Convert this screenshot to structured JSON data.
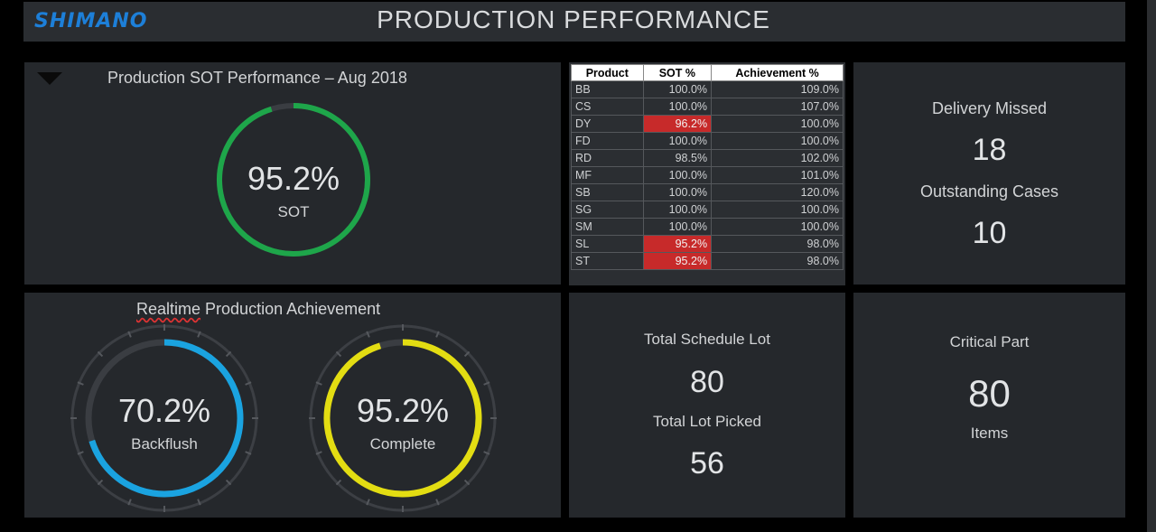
{
  "header": {
    "logo": "SHIMANO",
    "title": "PRODUCTION PERFORMANCE"
  },
  "sot_panel": {
    "title": "Production SOT Performance – Aug 2018",
    "value_text": "95.2%",
    "value": 95.2,
    "label": "SOT",
    "colors": {
      "ring": "#1ea64a",
      "track": "#3a3d42"
    }
  },
  "table": {
    "columns": [
      "Product",
      "SOT %",
      "Achievement %"
    ],
    "rows": [
      {
        "product": "BB",
        "sot": "100.0%",
        "achievement": "109.0%",
        "flag": false
      },
      {
        "product": "CS",
        "sot": "100.0%",
        "achievement": "107.0%",
        "flag": false
      },
      {
        "product": "DY",
        "sot": "96.2%",
        "achievement": "100.0%",
        "flag": true
      },
      {
        "product": "FD",
        "sot": "100.0%",
        "achievement": "100.0%",
        "flag": false
      },
      {
        "product": "RD",
        "sot": "98.5%",
        "achievement": "102.0%",
        "flag": false
      },
      {
        "product": "MF",
        "sot": "100.0%",
        "achievement": "101.0%",
        "flag": false
      },
      {
        "product": "SB",
        "sot": "100.0%",
        "achievement": "120.0%",
        "flag": false
      },
      {
        "product": "SG",
        "sot": "100.0%",
        "achievement": "100.0%",
        "flag": false
      },
      {
        "product": "SM",
        "sot": "100.0%",
        "achievement": "100.0%",
        "flag": false
      },
      {
        "product": "SL",
        "sot": "95.2%",
        "achievement": "98.0%",
        "flag": true
      },
      {
        "product": "ST",
        "sot": "95.2%",
        "achievement": "98.0%",
        "flag": true
      }
    ],
    "colors": {
      "flag": "#c72a2a"
    }
  },
  "delivery": {
    "missed_label": "Delivery Missed",
    "missed_value": "18",
    "outstanding_label": "Outstanding Cases",
    "outstanding_value": "10"
  },
  "realtime": {
    "title_word1": "Realtime",
    "title_rest": " Production Achievement",
    "gauges": [
      {
        "value_text": "70.2%",
        "value": 70.2,
        "label": "Backflush",
        "color": "#1aa3e0"
      },
      {
        "value_text": "95.2%",
        "value": 95.2,
        "label": "Complete",
        "color": "#e3dd12"
      }
    ]
  },
  "lots": {
    "schedule_label": "Total Schedule Lot",
    "schedule_value": "80",
    "picked_label": "Total Lot Picked",
    "picked_value": "56"
  },
  "critical": {
    "label": "Critical Part",
    "value": "80",
    "unit": "Items"
  }
}
